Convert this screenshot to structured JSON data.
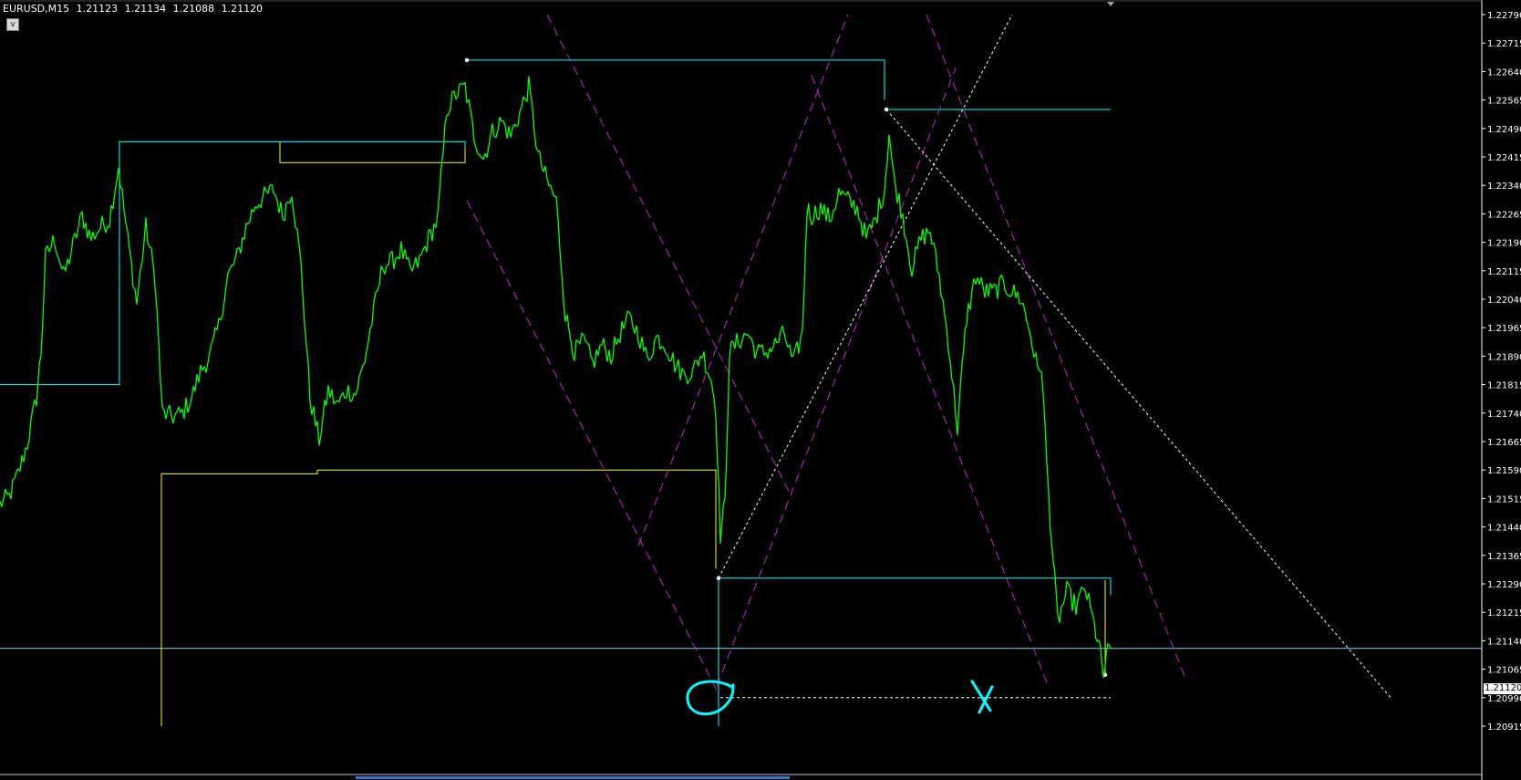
{
  "header": {
    "symbol_timeframe": "EURUSD,M15",
    "open": "1.21123",
    "high": "1.21134",
    "low": "1.21088",
    "close": "1.21120"
  },
  "collapse_button": {
    "label": "v"
  },
  "current_price_label": "1.21120",
  "colors": {
    "background": "#000000",
    "price_line": "#00ff00",
    "fractal_levels": "#00ffff",
    "swing_levels": "#ffff00",
    "channel_lines": "#bf2bbf",
    "fib_trend_lines": "#ffffff",
    "annotations": "#00ffff",
    "grid_frame": "#ffffff"
  },
  "chart_data": {
    "type": "line",
    "symbol": "EURUSD",
    "timeframe": "M15",
    "y_axis_ticks": [
      "1.22790",
      "1.22715",
      "1.22640",
      "1.22565",
      "1.22490",
      "1.22415",
      "1.22340",
      "1.22265",
      "1.22190",
      "1.22115",
      "1.22040",
      "1.21965",
      "1.21890",
      "1.21815",
      "1.21740",
      "1.21665",
      "1.21590",
      "1.21515",
      "1.21440",
      "1.21365",
      "1.21290",
      "1.21215",
      "1.21140",
      "1.21065",
      "1.20990",
      "1.20915"
    ],
    "ylim": [
      1.20905,
      1.2282
    ],
    "x_bars": [
      0,
      1300
    ],
    "grid": false,
    "series": [
      {
        "kind": "close",
        "points": [
          [
            0,
            1.215
          ],
          [
            10,
            1.2152
          ],
          [
            20,
            1.2158
          ],
          [
            30,
            1.2166
          ],
          [
            40,
            1.2178
          ],
          [
            45,
            1.219
          ],
          [
            50,
            1.2215
          ],
          [
            60,
            1.222
          ],
          [
            70,
            1.221
          ],
          [
            80,
            1.2218
          ],
          [
            90,
            1.2226
          ],
          [
            100,
            1.222
          ],
          [
            110,
            1.2223
          ],
          [
            120,
            1.2225
          ],
          [
            130,
            1.2239
          ],
          [
            140,
            1.222
          ],
          [
            150,
            1.2203
          ],
          [
            160,
            1.2223
          ],
          [
            170,
            1.221
          ],
          [
            178,
            1.2174
          ],
          [
            190,
            1.2173
          ],
          [
            200,
            1.2174
          ],
          [
            210,
            1.2178
          ],
          [
            220,
            1.2185
          ],
          [
            230,
            1.2189
          ],
          [
            240,
            1.2197
          ],
          [
            250,
            1.221
          ],
          [
            260,
            1.2215
          ],
          [
            270,
            1.2223
          ],
          [
            280,
            1.2229
          ],
          [
            290,
            1.2231
          ],
          [
            300,
            1.2233
          ],
          [
            310,
            1.2226
          ],
          [
            320,
            1.2233
          ],
          [
            330,
            1.2213
          ],
          [
            340,
            1.2178
          ],
          [
            350,
            1.2167
          ],
          [
            360,
            1.218
          ],
          [
            370,
            1.2176
          ],
          [
            380,
            1.218
          ],
          [
            390,
            1.2179
          ],
          [
            400,
            1.2188
          ],
          [
            410,
            1.2201
          ],
          [
            420,
            1.2213
          ],
          [
            430,
            1.2214
          ],
          [
            440,
            1.2217
          ],
          [
            450,
            1.2211
          ],
          [
            460,
            1.2214
          ],
          [
            470,
            1.222
          ],
          [
            480,
            1.2225
          ],
          [
            490,
            1.2254
          ],
          [
            500,
            1.2258
          ],
          [
            510,
            1.226
          ],
          [
            520,
            1.2247
          ],
          [
            530,
            1.2241
          ],
          [
            540,
            1.2248
          ],
          [
            550,
            1.2251
          ],
          [
            560,
            1.2247
          ],
          [
            570,
            1.2253
          ],
          [
            580,
            1.226
          ],
          [
            590,
            1.2242
          ],
          [
            600,
            1.2235
          ],
          [
            610,
            1.223
          ],
          [
            620,
            1.22
          ],
          [
            630,
            1.219
          ],
          [
            640,
            1.2193
          ],
          [
            650,
            1.2187
          ],
          [
            660,
            1.2192
          ],
          [
            670,
            1.2189
          ],
          [
            680,
            1.2195
          ],
          [
            690,
            1.2199
          ],
          [
            700,
            1.2195
          ],
          [
            710,
            1.2188
          ],
          [
            720,
            1.2194
          ],
          [
            730,
            1.2192
          ],
          [
            740,
            1.2187
          ],
          [
            750,
            1.2184
          ],
          [
            760,
            1.2185
          ],
          [
            770,
            1.219
          ],
          [
            780,
            1.2183
          ],
          [
            785,
            1.2175
          ],
          [
            790,
            1.2142
          ],
          [
            795,
            1.215
          ],
          [
            800,
            1.219
          ],
          [
            810,
            1.2193
          ],
          [
            820,
            1.2195
          ],
          [
            830,
            1.219
          ],
          [
            840,
            1.219
          ],
          [
            850,
            1.2192
          ],
          [
            860,
            1.2195
          ],
          [
            870,
            1.2187
          ],
          [
            880,
            1.2195
          ],
          [
            885,
            1.2228
          ],
          [
            890,
            1.2226
          ],
          [
            900,
            1.2228
          ],
          [
            910,
            1.2225
          ],
          [
            920,
            1.2232
          ],
          [
            930,
            1.223
          ],
          [
            940,
            1.2228
          ],
          [
            950,
            1.222
          ],
          [
            960,
            1.2225
          ],
          [
            970,
            1.2233
          ],
          [
            975,
            1.2248
          ],
          [
            980,
            1.2236
          ],
          [
            990,
            1.2226
          ],
          [
            1000,
            1.2212
          ],
          [
            1010,
            1.222
          ],
          [
            1020,
            1.2222
          ],
          [
            1030,
            1.221
          ],
          [
            1040,
            1.2193
          ],
          [
            1050,
            1.217
          ],
          [
            1055,
            1.2185
          ],
          [
            1060,
            1.2199
          ],
          [
            1070,
            1.221
          ],
          [
            1080,
            1.2206
          ],
          [
            1090,
            1.2206
          ],
          [
            1100,
            1.2208
          ],
          [
            1110,
            1.2206
          ],
          [
            1120,
            1.2204
          ],
          [
            1130,
            1.2195
          ],
          [
            1138,
            1.2185
          ],
          [
            1142,
            1.2187
          ],
          [
            1150,
            1.2152
          ],
          [
            1155,
            1.2135
          ],
          [
            1160,
            1.2119
          ],
          [
            1170,
            1.2127
          ],
          [
            1180,
            1.2123
          ],
          [
            1190,
            1.2128
          ],
          [
            1200,
            1.2118
          ],
          [
            1205,
            1.2113
          ],
          [
            1210,
            1.2105
          ],
          [
            1215,
            1.2111
          ],
          [
            1218,
            1.2112
          ]
        ]
      }
    ],
    "annotations": [
      {
        "kind": "circle_mark",
        "x_bar": 780,
        "y": 1.2099
      },
      {
        "kind": "x_mark",
        "x_bar": 1078,
        "y": 1.2099
      }
    ]
  }
}
